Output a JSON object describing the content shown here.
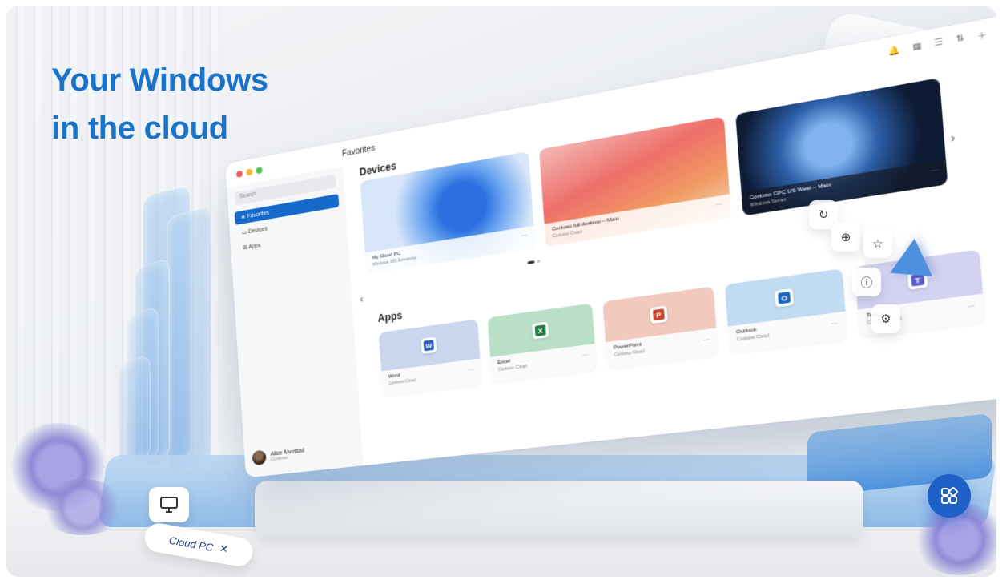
{
  "headline": {
    "line1": "Your Windows",
    "line2": "in the cloud"
  },
  "window": {
    "title": "Favorites",
    "search_placeholder": "Search",
    "sidebar": [
      {
        "label": "Favorites",
        "icon": "star-icon",
        "active": true
      },
      {
        "label": "Devices",
        "icon": "monitor-icon",
        "active": false
      },
      {
        "label": "Apps",
        "icon": "grid-icon",
        "active": false
      }
    ],
    "user": {
      "name": "Alice Alvestad",
      "role": "Contoso"
    },
    "devices_title": "Devices",
    "devices": [
      {
        "name": "My Cloud PC",
        "sub": "Windows 365 Enterprise",
        "theme": "light-blue"
      },
      {
        "name": "Contoso full desktop – Main",
        "sub": "Contoso Cloud",
        "theme": "coral"
      },
      {
        "name": "Contoso CPC US West – Main",
        "sub": "Windows Server",
        "theme": "dark"
      }
    ],
    "apps_title": "Apps",
    "apps": [
      {
        "name": "Word",
        "sub": "Contoso Cloud",
        "letter": "W",
        "color": "#2b5fb8",
        "bg": "#c9d6ee"
      },
      {
        "name": "Excel",
        "sub": "Contoso Cloud",
        "letter": "X",
        "color": "#1f7a44",
        "bg": "#b9dfc7"
      },
      {
        "name": "PowerPoint",
        "sub": "Contoso Cloud",
        "letter": "P",
        "color": "#c9472d",
        "bg": "#f2c9bd"
      },
      {
        "name": "Outlook",
        "sub": "Contoso Cloud",
        "letter": "O",
        "color": "#1a67c1",
        "bg": "#c1dcf2"
      },
      {
        "name": "Teams",
        "sub": "Contoso Cloud",
        "letter": "T",
        "color": "#5b5fc7",
        "bg": "#d3d2f0"
      }
    ],
    "more_label": "···"
  },
  "floating": {
    "cloud_chip_label": "Cloud PC",
    "tiles": [
      "refresh-icon",
      "zoom-icon",
      "star-icon",
      "info-icon",
      "settings-icon"
    ]
  },
  "colors": {
    "accent": "#1a73c8",
    "brand_blue": "#1e5fc8",
    "active_nav": "#1669c9"
  }
}
